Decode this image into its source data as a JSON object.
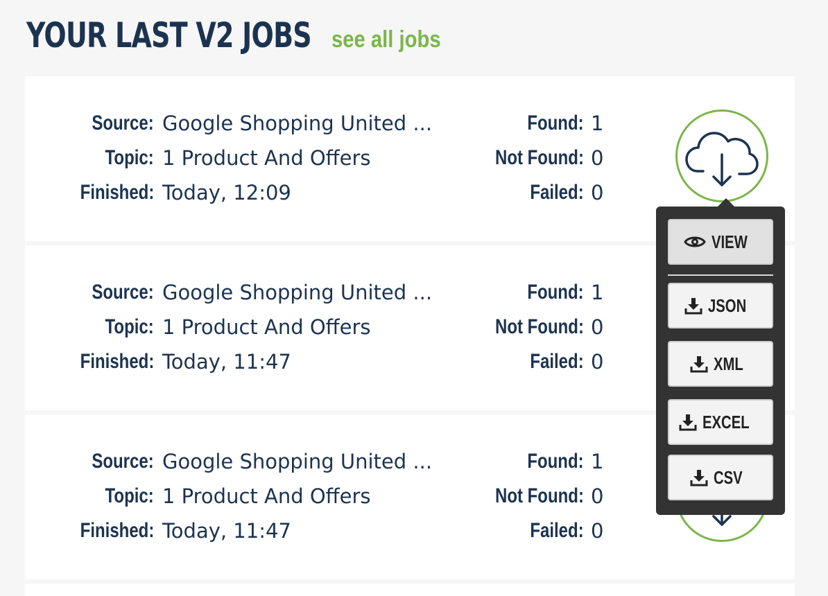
{
  "header": {
    "title": "YOUR LAST V2 JOBS",
    "link": "see all jobs"
  },
  "labels": {
    "source": "Source:",
    "topic": "Topic:",
    "finished": "Finished:",
    "found": "Found:",
    "not_found": "Not Found:",
    "failed": "Failed:"
  },
  "jobs": [
    {
      "source": "Google Shopping United ...",
      "topic": "1 Product And Offers",
      "finished": "Today, 12:09",
      "found": "1",
      "not_found": "0",
      "failed": "0"
    },
    {
      "source": "Google Shopping United ...",
      "topic": "1 Product And Offers",
      "finished": "Today, 11:47",
      "found": "1",
      "not_found": "0",
      "failed": "0"
    },
    {
      "source": "Google Shopping United ...",
      "topic": "1 Product And Offers",
      "finished": "Today, 11:47",
      "found": "1",
      "not_found": "0",
      "failed": "0"
    }
  ],
  "download_menu": {
    "view": "VIEW",
    "json": "JSON",
    "xml": "XML",
    "excel": "EXCEL",
    "csv": "CSV"
  },
  "colors": {
    "accent": "#7ab648",
    "text": "#1c3350",
    "popover": "#333333"
  },
  "icons": {
    "download": "cloud-download-icon",
    "view": "eye-icon",
    "file_download": "download-icon"
  }
}
